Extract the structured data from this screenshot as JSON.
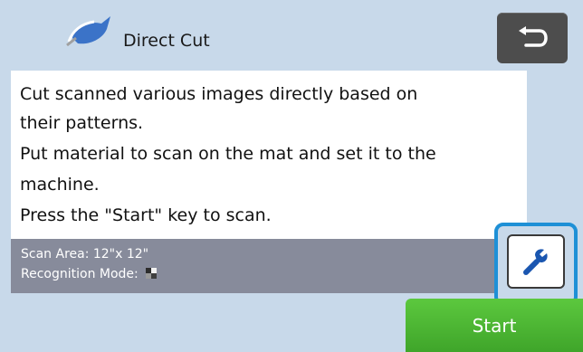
{
  "header": {
    "title": "Direct Cut",
    "app_icon": "direct-cut-icon",
    "back_icon": "back-arrow-icon"
  },
  "message": {
    "lines": [
      "Cut scanned various images directly based on",
      "their patterns.",
      "Put material to scan on the mat and set it to the",
      "machine.",
      "Press the \"Start\" key to scan."
    ]
  },
  "info": {
    "scan_area": "Scan Area: 12\"x 12\"",
    "recognition_mode": "Recognition Mode:",
    "recognition_mode_icon": "grayscale-pattern-icon"
  },
  "settings": {
    "icon": "wrench-icon",
    "highlight_color": "#1e90d6"
  },
  "start_button": {
    "label": "Start",
    "color": "#4cb834"
  }
}
